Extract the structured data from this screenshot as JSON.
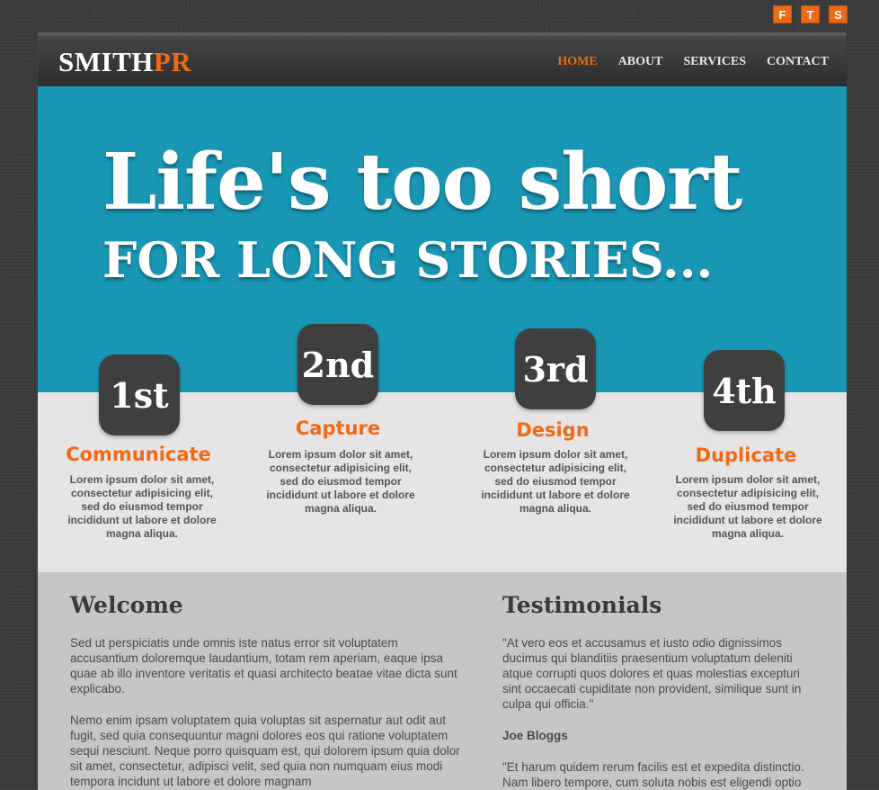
{
  "social": {
    "items": [
      "F",
      "T",
      "S"
    ]
  },
  "header": {
    "logo_a": "SMITH",
    "logo_b": "PR",
    "nav": [
      "HOME",
      "ABOUT",
      "SERVICES",
      "CONTACT"
    ]
  },
  "hero": {
    "headline": "Life's too short",
    "subheadline": "FOR LONG STORIES..."
  },
  "steps": [
    {
      "badge": "1st",
      "title": "Communicate",
      "text": "Lorem ipsum dolor sit amet, consectetur adipisicing elit, sed do eiusmod tempor incididunt ut labore et dolore magna aliqua."
    },
    {
      "badge": "2nd",
      "title": "Capture",
      "text": "Lorem ipsum dolor sit amet, consectetur adipisicing elit, sed do eiusmod tempor incididunt ut labore et dolore magna aliqua."
    },
    {
      "badge": "3rd",
      "title": "Design",
      "text": "Lorem ipsum dolor sit amet, consectetur adipisicing elit, sed do eiusmod tempor incididunt ut labore et dolore magna aliqua."
    },
    {
      "badge": "4th",
      "title": "Duplicate",
      "text": "Lorem ipsum dolor sit amet, consectetur adipisicing elit, sed do eiusmod tempor incididunt ut labore et dolore magna aliqua."
    }
  ],
  "welcome": {
    "title": "Welcome",
    "p1": "Sed ut perspiciatis unde omnis iste natus error sit voluptatem accusantium doloremque laudantium, totam rem aperiam, eaque ipsa quae ab illo inventore veritatis et quasi architecto beatae vitae dicta sunt explicabo.",
    "p2": "Nemo enim ipsam voluptatem quia voluptas sit aspernatur aut odit aut fugit, sed quia consequuntur magni dolores eos qui ratione voluptatem sequi nesciunt. Neque porro quisquam est, qui dolorem ipsum quia dolor sit amet, consectetur, adipisci velit, sed quia non numquam eius modi tempora incidunt ut labore et dolore magnam"
  },
  "testimonials": {
    "title": "Testimonials",
    "quote1": "\"At vero eos et accusamus et iusto odio dignissimos ducimus qui blanditiis praesentium voluptatum deleniti atque corrupti quos dolores et quas molestias excepturi sint occaecati cupiditate non provident, similique sunt in culpa qui officia.\"",
    "author1": "Joe Bloggs",
    "quote2": "\"Et harum quidem rerum facilis est et expedita distinctio. Nam libero tempore, cum soluta nobis est eligendi optio"
  },
  "colors": {
    "accent": "#ee6a17",
    "hero_blue": "#1595b3",
    "badge": "#3f3f3f",
    "steps_bg": "#e6e4e5",
    "content_bg": "#c6c6c6"
  }
}
